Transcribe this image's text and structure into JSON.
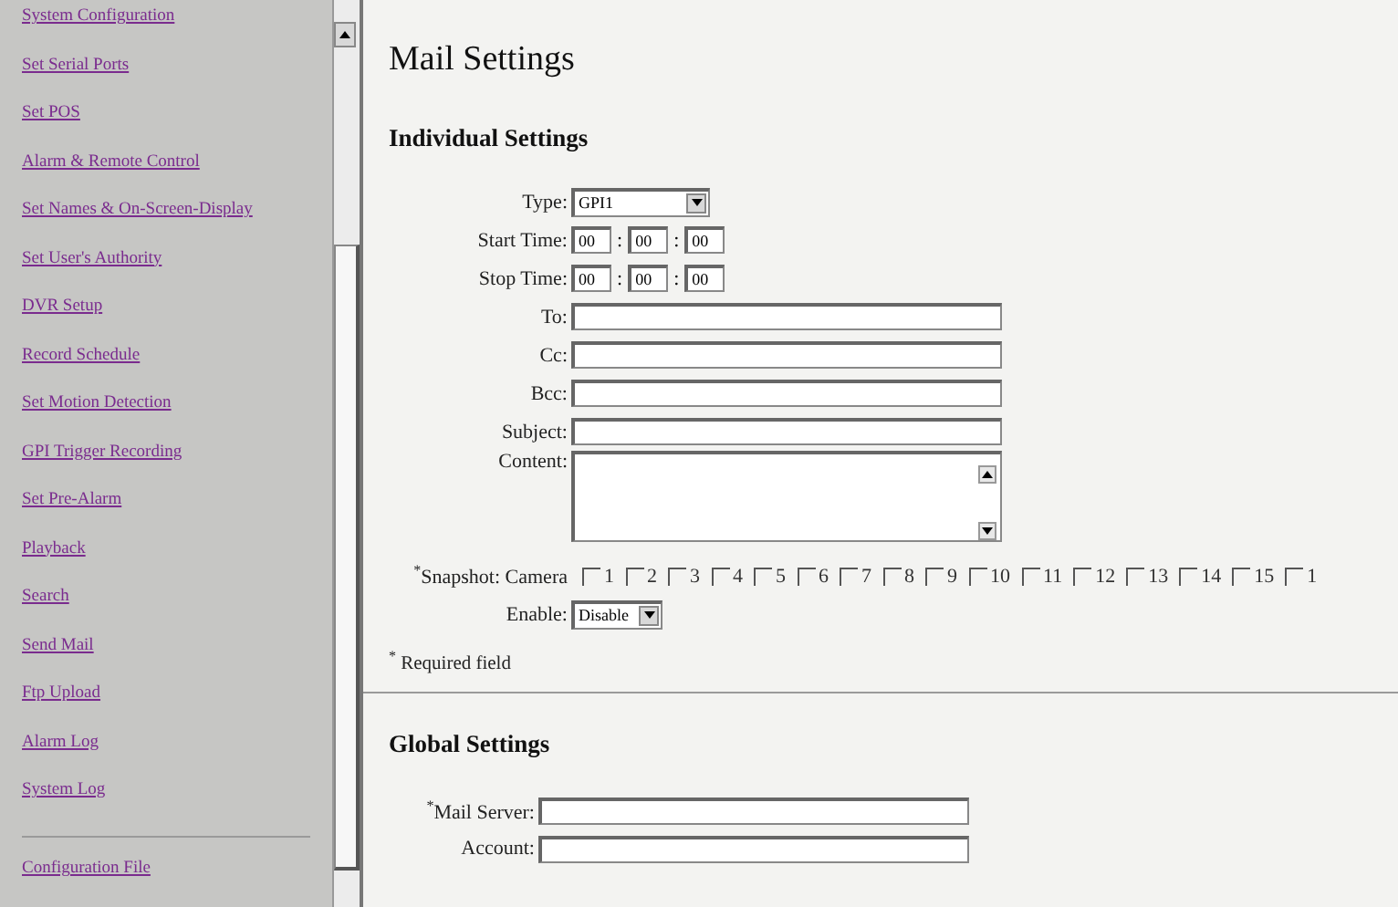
{
  "sidebar": {
    "items": [
      {
        "label": "System Configuration"
      },
      {
        "label": "Set Serial Ports"
      },
      {
        "label": "Set POS"
      },
      {
        "label": "Alarm & Remote Control"
      },
      {
        "label": "Set Names & On-Screen-Display"
      },
      {
        "label": "Set User's Authority"
      },
      {
        "label": "DVR Setup"
      },
      {
        "label": "Record Schedule"
      },
      {
        "label": "Set Motion Detection"
      },
      {
        "label": "GPI Trigger Recording"
      },
      {
        "label": "Set Pre-Alarm"
      },
      {
        "label": "Playback"
      },
      {
        "label": "Search"
      },
      {
        "label": "Send Mail"
      },
      {
        "label": "Ftp Upload"
      },
      {
        "label": "Alarm Log"
      },
      {
        "label": "System Log"
      }
    ],
    "footer_items": [
      {
        "label": "Configuration File"
      }
    ]
  },
  "page": {
    "title": "Mail Settings",
    "individual": {
      "heading": "Individual Settings",
      "type": {
        "label": "Type:",
        "value": "GPI1"
      },
      "start_time": {
        "label": "Start Time:",
        "parts": [
          "00",
          "00",
          "00"
        ],
        "separator": ":"
      },
      "stop_time": {
        "label": "Stop Time:",
        "parts": [
          "00",
          "00",
          "00"
        ],
        "separator": ":"
      },
      "fields": [
        {
          "label": "To:"
        },
        {
          "label": "Cc:"
        },
        {
          "label": "Bcc:"
        },
        {
          "label": "Subject:"
        }
      ],
      "content": {
        "label": "Content:"
      },
      "snapshot": {
        "required_mark": "*",
        "label": "Snapshot: Camera",
        "cameras": [
          {
            "label": "1",
            "checked": false
          },
          {
            "label": "2",
            "checked": false
          },
          {
            "label": "3",
            "checked": false
          },
          {
            "label": "4",
            "checked": false
          },
          {
            "label": "5",
            "checked": false
          },
          {
            "label": "6",
            "checked": false
          },
          {
            "label": "7",
            "checked": false
          },
          {
            "label": "8",
            "checked": false
          },
          {
            "label": "9",
            "checked": false
          },
          {
            "label": "10",
            "checked": false
          },
          {
            "label": "11",
            "checked": false
          },
          {
            "label": "12",
            "checked": false
          },
          {
            "label": "13",
            "checked": false
          },
          {
            "label": "14",
            "checked": false
          },
          {
            "label": "15",
            "checked": false
          },
          {
            "label": "1",
            "checked": false
          }
        ]
      },
      "enable": {
        "label": "Enable:",
        "value": "Disable"
      },
      "note": {
        "mark": "*",
        "text": "Required field"
      }
    },
    "global": {
      "heading": "Global Settings",
      "fields": [
        {
          "label": "Mail Server:",
          "required": true
        },
        {
          "label": "Account:",
          "required": false
        }
      ]
    }
  }
}
